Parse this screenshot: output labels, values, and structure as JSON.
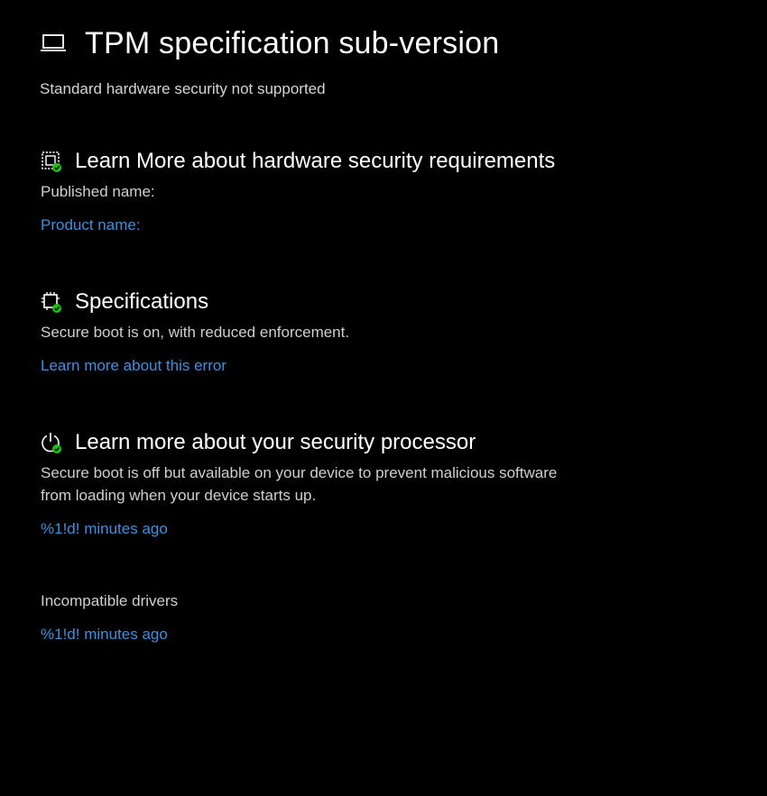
{
  "header": {
    "title": "TPM specification sub-version",
    "subtitle": "Standard hardware security not supported",
    "icon": "laptop-icon"
  },
  "sections": [
    {
      "icon": "chip-check-icon",
      "title": "Learn More about hardware security requirements",
      "text": "Published name:",
      "link": "Product name:"
    },
    {
      "icon": "processor-check-icon",
      "title": "Specifications",
      "text": "Secure boot is on, with reduced enforcement.",
      "link": "Learn more about this error"
    },
    {
      "icon": "power-check-icon",
      "title": "Learn more about your security processor",
      "text": "Secure boot is off but available on your device to prevent malicious software from loading when your device starts up.",
      "link": "%1!d! minutes ago"
    }
  ],
  "drivers": {
    "label": "Incompatible drivers",
    "link": "%1!d! minutes ago"
  },
  "colors": {
    "background": "#000000",
    "text": "#ffffff",
    "secondary_text": "#cfcfcf",
    "link": "#3d8fe0",
    "check_badge": "#16c60c"
  }
}
